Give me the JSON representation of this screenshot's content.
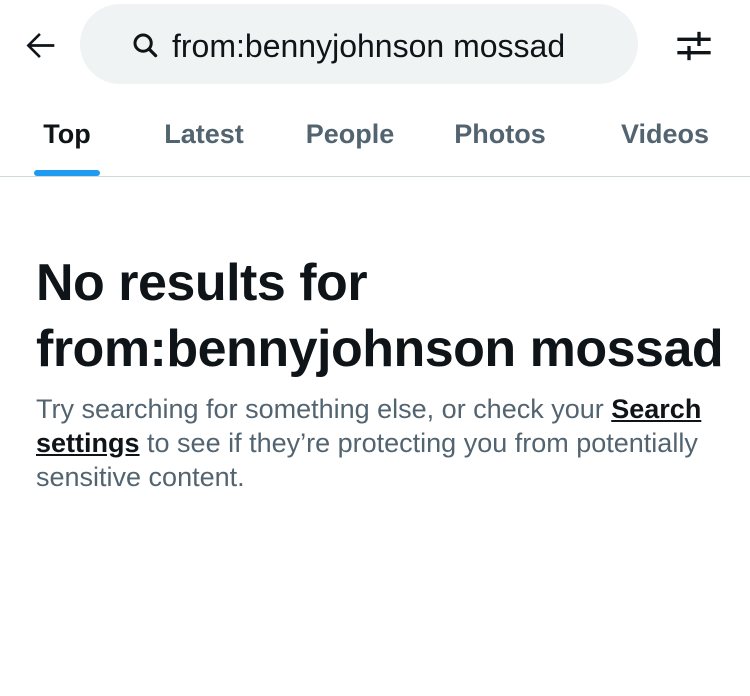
{
  "header": {
    "back_icon": "arrow-left-icon",
    "search_icon": "search-icon",
    "search_query": "from:bennyjohnson mossad",
    "filter_icon": "sliders-icon"
  },
  "tabs": [
    {
      "label": "Top",
      "active": true
    },
    {
      "label": "Latest",
      "active": false
    },
    {
      "label": "People",
      "active": false
    },
    {
      "label": "Photos",
      "active": false
    },
    {
      "label": "Videos",
      "active": false
    }
  ],
  "empty_state": {
    "title": "No results for from:bennyjohnson mossad",
    "body_before_link": "Try searching for something else, or check your ",
    "link_text": "Search settings",
    "body_after_link": " to see if they’re protecting you from potentially sensitive content."
  },
  "colors": {
    "accent": "#1d9bf0",
    "text_primary": "#0f1419",
    "text_secondary": "#536471",
    "search_bg": "#eff3f4",
    "divider": "#cfd9de"
  }
}
